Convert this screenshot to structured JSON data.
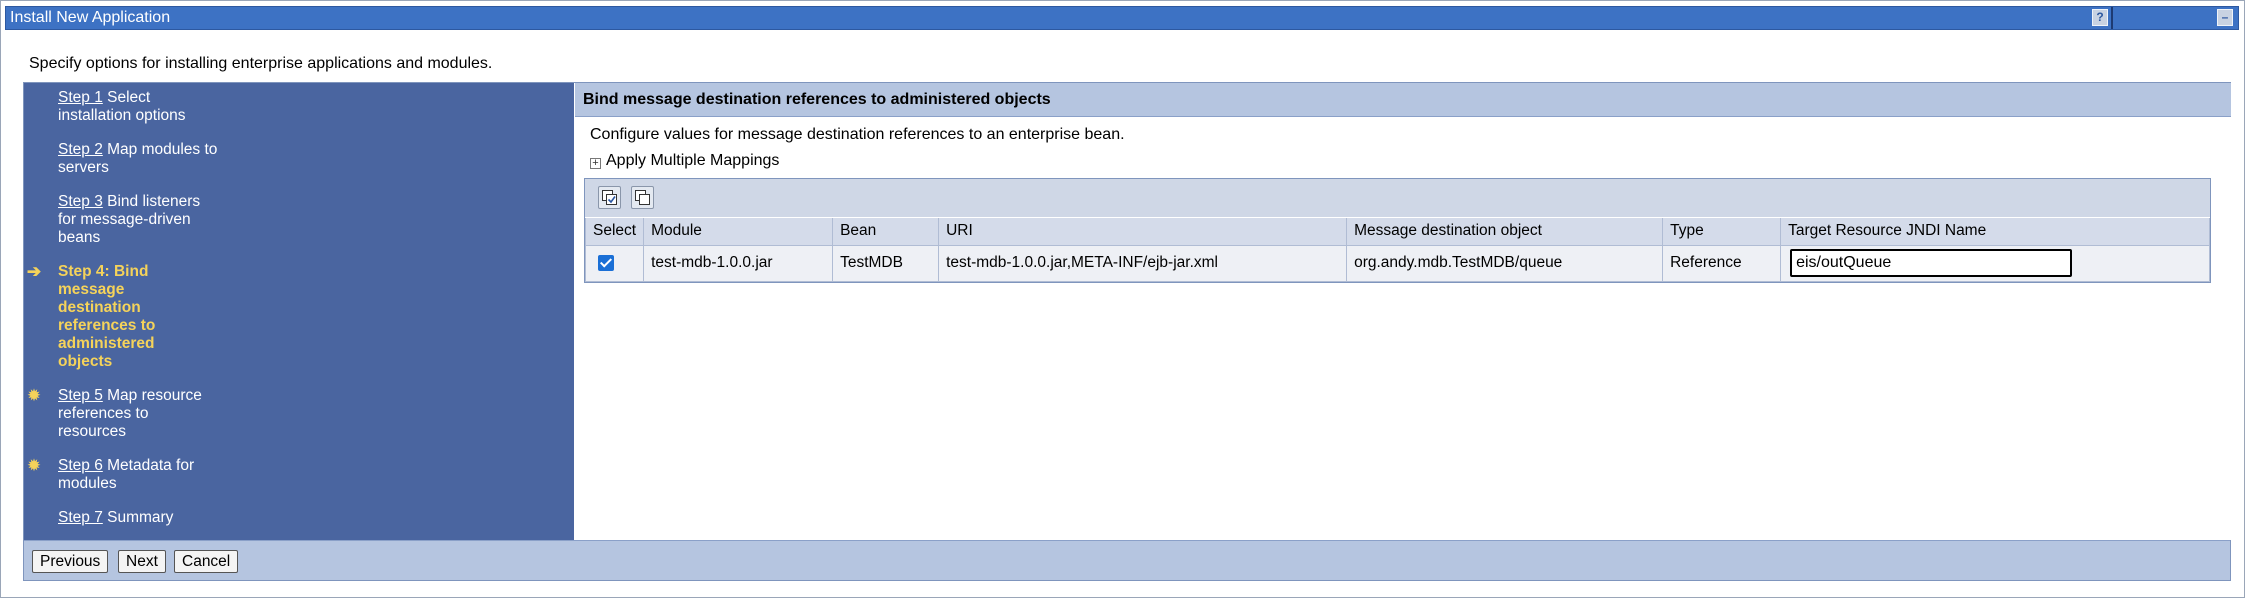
{
  "window": {
    "title": "Install New Application",
    "help_icon": "question-mark",
    "minimize_icon": "minimize"
  },
  "intro": "Specify options for installing enterprise applications and modules.",
  "steps": [
    {
      "num": "Step 1",
      "text": " Select installation options",
      "status": "done",
      "icon": ""
    },
    {
      "num": "Step 2",
      "text": " Map modules to servers",
      "status": "done",
      "icon": ""
    },
    {
      "num": "Step 3",
      "text": " Bind listeners for message-driven beans",
      "status": "done",
      "icon": ""
    },
    {
      "num": "Step 4: Bind message destination references to administered objects",
      "text": "",
      "status": "current",
      "icon": "arrow-right"
    },
    {
      "num": "Step 5",
      "text": " Map resource references to resources",
      "status": "pending",
      "icon": "starburst"
    },
    {
      "num": "Step 6",
      "text": " Metadata for modules",
      "status": "pending",
      "icon": "starburst"
    },
    {
      "num": "Step 7",
      "text": " Summary",
      "status": "pending",
      "icon": ""
    }
  ],
  "content": {
    "header": "Bind message destination references to administered objects",
    "description": "Configure values for message destination references to an enterprise bean.",
    "apply_multiple": "Apply Multiple Mappings",
    "toolbar_icons": [
      "select-all-icon",
      "deselect-all-icon"
    ],
    "columns": [
      "Select",
      "Module",
      "Bean",
      "URI",
      "Message destination object",
      "Type",
      "Target Resource JNDI Name"
    ],
    "rows": [
      {
        "selected": true,
        "module": "test-mdb-1.0.0.jar",
        "bean": "TestMDB",
        "uri": "test-mdb-1.0.0.jar,META-INF/ejb-jar.xml",
        "destination": "org.andy.mdb.TestMDB/queue",
        "type": "Reference",
        "jndi": "eis/outQueue"
      }
    ]
  },
  "buttons": {
    "previous": "Previous",
    "next": "Next",
    "cancel": "Cancel"
  },
  "colors": {
    "title_bar": "#3d72c4",
    "steps_panel": "#4a65a0",
    "current_step": "#f5d35a",
    "header_band": "#b5c5e0"
  }
}
